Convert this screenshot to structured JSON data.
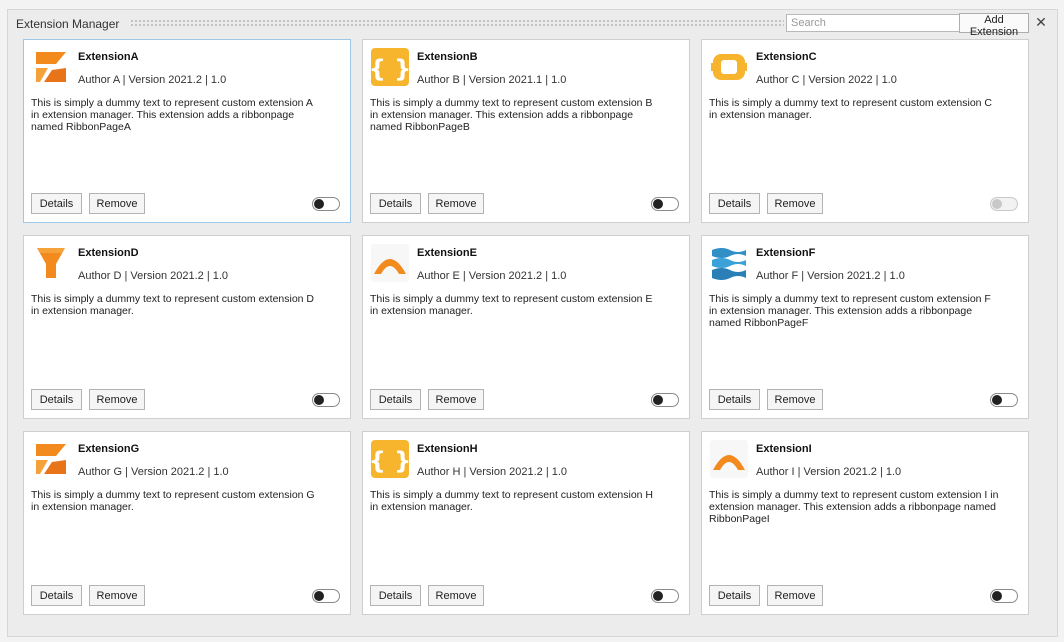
{
  "window": {
    "title": "Extension Manager",
    "search_placeholder": "Search",
    "add_button_label": "Add Extension",
    "close_glyph": "✕"
  },
  "card_labels": {
    "details": "Details",
    "remove": "Remove"
  },
  "extensions": [
    {
      "name": "ExtensionA",
      "meta": "Author A | Version 2021.2 | 1.0",
      "description": "This is simply a dummy text to represent custom extension A in extension manager. This extension adds a ribbonpage named RibbonPageA",
      "icon": "orange-arrow-squares-icon",
      "enabled": false,
      "toggle_disabled": false
    },
    {
      "name": "ExtensionB",
      "meta": "Author B | Version 2021.1 | 1.0",
      "description": "This is simply a dummy text to represent custom extension B in extension manager. This extension adds a ribbonpage named RibbonPageB",
      "icon": "curly-braces-icon",
      "enabled": false,
      "toggle_disabled": false
    },
    {
      "name": "ExtensionC",
      "meta": "Author C | Version 2022 | 1.0",
      "description": "This is simply a dummy text to represent custom extension C in extension manager.",
      "icon": "gear-ring-icon",
      "enabled": false,
      "toggle_disabled": true
    },
    {
      "name": "ExtensionD",
      "meta": "Author D | Version 2021.2 | 1.0",
      "description": "This is simply a dummy text to represent custom extension D in extension manager.",
      "icon": "funnel-icon",
      "enabled": false,
      "toggle_disabled": false
    },
    {
      "name": "ExtensionE",
      "meta": "Author E | Version 2021.2 | 1.0",
      "description": "This is simply a dummy text to represent custom extension E in extension manager.",
      "icon": "orange-arch-icon",
      "enabled": false,
      "toggle_disabled": false
    },
    {
      "name": "ExtensionF",
      "meta": "Author F | Version 2021.2 | 1.0",
      "description": "This is simply a dummy text to represent custom extension F in extension manager. This extension adds a ribbonpage named RibbonPageF",
      "icon": "blue-waves-icon",
      "enabled": false,
      "toggle_disabled": false
    },
    {
      "name": "ExtensionG",
      "meta": "Author G | Version 2021.2 | 1.0",
      "description": "This is simply a dummy text to represent custom extension G in extension manager.",
      "icon": "orange-arrow-squares-icon",
      "enabled": false,
      "toggle_disabled": false
    },
    {
      "name": "ExtensionH",
      "meta": "Author H | Version 2021.2 | 1.0",
      "description": "This is simply a dummy text to represent custom extension H in extension manager.",
      "icon": "curly-braces-icon",
      "enabled": false,
      "toggle_disabled": false
    },
    {
      "name": "ExtensionI",
      "meta": "Author I | Version 2021.2 | 1.0",
      "description": "This is simply a dummy text to represent custom extension I in extension manager. This extension adds a ribbonpage named RibbonPageI",
      "icon": "orange-arch-icon",
      "enabled": false,
      "toggle_disabled": false
    }
  ],
  "colors": {
    "accent_orange": "#f28a1e",
    "accent_yellow": "#f6b52c",
    "accent_blue": "#2f8fc6",
    "selection_border": "#9cc9ea"
  }
}
